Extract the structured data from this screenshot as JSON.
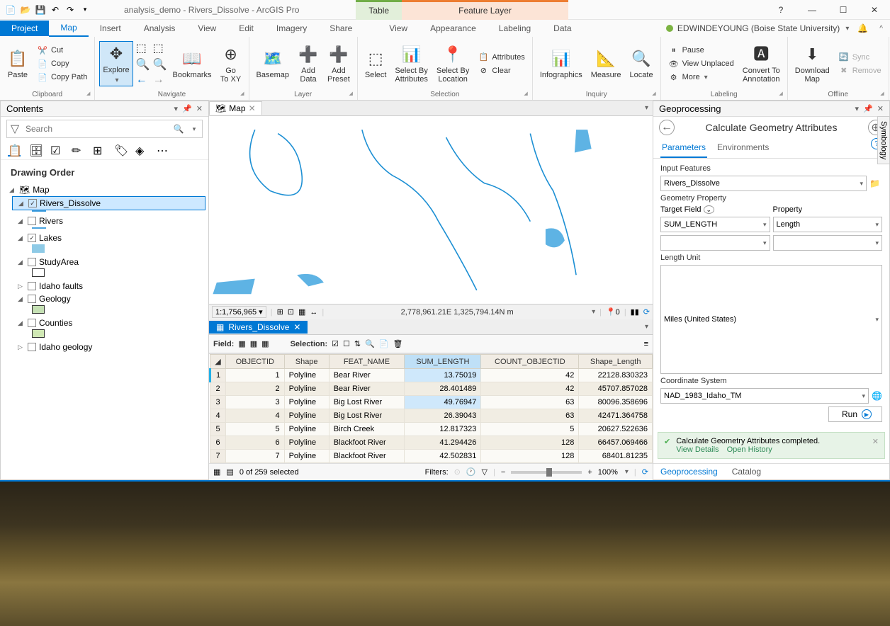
{
  "titlebar": {
    "title": "analysis_demo - Rivers_Dissolve - ArcGIS Pro",
    "ctx_table": "Table",
    "ctx_feature": "Feature Layer"
  },
  "menu": {
    "project": "Project",
    "map": "Map",
    "insert": "Insert",
    "analysis": "Analysis",
    "view": "View",
    "edit": "Edit",
    "imagery": "Imagery",
    "share": "Share",
    "table_view": "View",
    "appearance": "Appearance",
    "labeling": "Labeling",
    "data": "Data",
    "user": "EDWINDEYOUNG (Boise State University)"
  },
  "ribbon": {
    "clipboard": {
      "label": "Clipboard",
      "paste": "Paste",
      "cut": "Cut",
      "copy": "Copy",
      "copypath": "Copy Path"
    },
    "navigate": {
      "label": "Navigate",
      "explore": "Explore",
      "bookmarks": "Bookmarks",
      "goto": "Go\nTo XY"
    },
    "layer": {
      "label": "Layer",
      "basemap": "Basemap",
      "adddata": "Add\nData",
      "addpreset": "Add\nPreset"
    },
    "selection": {
      "label": "Selection",
      "select": "Select",
      "selattr": "Select By\nAttributes",
      "selloc": "Select By\nLocation",
      "attributes": "Attributes",
      "clear": "Clear"
    },
    "inquiry": {
      "label": "Inquiry",
      "infographics": "Infographics",
      "measure": "Measure",
      "locate": "Locate"
    },
    "labeling": {
      "label": "Labeling",
      "pause": "Pause",
      "unplaced": "View Unplaced",
      "more": "More",
      "convert": "Convert To\nAnnotation"
    },
    "offline": {
      "label": "Offline",
      "download": "Download\nMap",
      "sync": "Sync",
      "remove": "Remove"
    }
  },
  "contents": {
    "title": "Contents",
    "search_placeholder": "Search",
    "heading": "Drawing Order",
    "map": "Map",
    "layers": {
      "rivers_dissolve": "Rivers_Dissolve",
      "rivers": "Rivers",
      "lakes": "Lakes",
      "studyarea": "StudyArea",
      "idaho_faults": "Idaho faults",
      "geology": "Geology",
      "counties": "Counties",
      "idaho_geology": "Idaho geology"
    }
  },
  "map_view": {
    "tab": "Map",
    "scale": "1:1,756,965",
    "coords": "2,778,961.21E 1,325,794.14N m"
  },
  "table": {
    "tab": "Rivers_Dissolve",
    "field_label": "Field:",
    "selection_label": "Selection:",
    "cols": [
      "OBJECTID",
      "Shape",
      "FEAT_NAME",
      "SUM_LENGTH",
      "COUNT_OBJECTID",
      "Shape_Length"
    ],
    "rows": [
      {
        "n": 1,
        "oid": "1",
        "shape": "Polyline",
        "feat": "Bear River",
        "sum": "13.75019",
        "count": "42",
        "len": "22128.830323",
        "sel": true
      },
      {
        "n": 2,
        "oid": "2",
        "shape": "Polyline",
        "feat": "Bear River",
        "sum": "28.401489",
        "count": "42",
        "len": "45707.857028"
      },
      {
        "n": 3,
        "oid": "3",
        "shape": "Polyline",
        "feat": "Big Lost River",
        "sum": "49.76947",
        "count": "63",
        "len": "80096.358696",
        "hl": true
      },
      {
        "n": 4,
        "oid": "4",
        "shape": "Polyline",
        "feat": "Big Lost River",
        "sum": "26.39043",
        "count": "63",
        "len": "42471.364758"
      },
      {
        "n": 5,
        "oid": "5",
        "shape": "Polyline",
        "feat": "Birch Creek",
        "sum": "12.817323",
        "count": "5",
        "len": "20627.522636"
      },
      {
        "n": 6,
        "oid": "6",
        "shape": "Polyline",
        "feat": "Blackfoot River",
        "sum": "41.294426",
        "count": "128",
        "len": "66457.069466"
      },
      {
        "n": 7,
        "oid": "7",
        "shape": "Polyline",
        "feat": "Blackfoot River",
        "sum": "42.502831",
        "count": "128",
        "len": "68401.81235"
      }
    ],
    "status": "0 of 259 selected",
    "filters": "Filters:",
    "zoom": "100%"
  },
  "gp": {
    "title": "Geoprocessing",
    "tool": "Calculate Geometry Attributes",
    "params": "Parameters",
    "envs": "Environments",
    "input_features": "Input Features",
    "input_val": "Rivers_Dissolve",
    "geom_prop": "Geometry Property",
    "target_field": "Target Field",
    "property": "Property",
    "target_val": "SUM_LENGTH",
    "prop_val": "Length",
    "length_unit": "Length Unit",
    "length_val": "Miles (United States)",
    "coord_sys": "Coordinate System",
    "coord_val": "NAD_1983_Idaho_TM",
    "run": "Run",
    "msg": "Calculate Geometry Attributes completed.",
    "details": "View Details",
    "history": "Open History",
    "tab_gp": "Geoprocessing",
    "tab_catalog": "Catalog"
  },
  "side": {
    "symbology": "Symbology"
  }
}
